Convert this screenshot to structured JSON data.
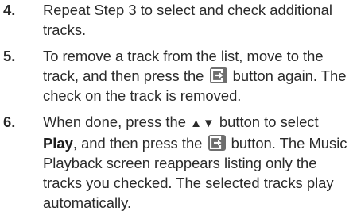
{
  "steps": [
    {
      "number": "4.",
      "text": "Repeat Step 3 to select and check additional tracks."
    },
    {
      "number": "5.",
      "text_before_icon": "To remove a track from the list, move to the track, and then press the",
      "icon": "enter-button-icon",
      "text_after_icon": "button again. The check on the track is removed."
    },
    {
      "number": "6.",
      "text_part1": "When done, press the",
      "arrows": "▲▼",
      "text_part2": "button to select",
      "bold_word": "Play",
      "text_part3": ", and then press the",
      "icon": "enter-button-icon",
      "text_part4": "button. The Music Playback screen reappears listing only the tracks you checked. The selected tracks play automatically."
    }
  ],
  "colors": {
    "text": "#2b2b2b",
    "icon_background": "#6e6e6e",
    "icon_foreground": "#ffffff"
  }
}
